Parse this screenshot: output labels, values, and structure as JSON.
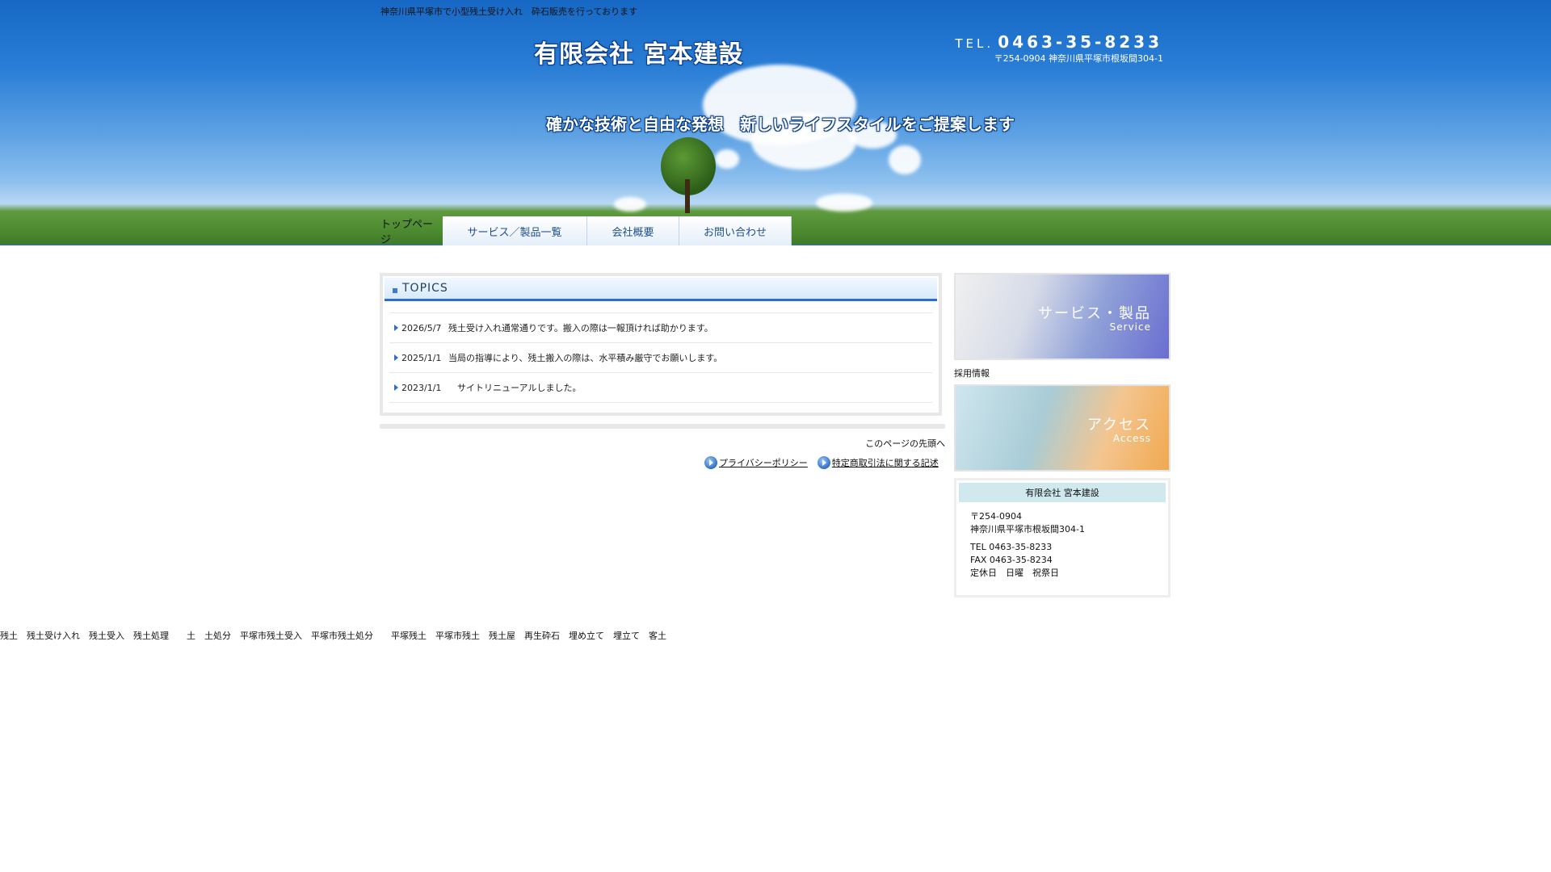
{
  "header": {
    "tagline_top": "神奈川県平塚市で小型残土受け入れ　砕石販売を行っております",
    "logo_text": "有限会社 宮本建設",
    "tel_label": "TEL.",
    "tel_number": "0463-35-8233",
    "address": "〒254-0904 神奈川県平塚市根坂間304-1",
    "catchphrase": "確かな技術と自由な発想　新しいライフスタイルをご提案します"
  },
  "nav": {
    "home": "トップページ",
    "items": [
      "サービス／製品一覧",
      "会社概要",
      "お問い合わせ"
    ]
  },
  "topics": {
    "title": "TOPICS",
    "items": [
      {
        "date": "2026/5/7",
        "text": "残土受け入れ通常通りです。搬入の際は一報頂ければ助かります。"
      },
      {
        "date": "2025/1/1",
        "text": "当局の指導により、残土搬入の際は、水平積み厳守でお願いします。"
      },
      {
        "date": "2023/1/1",
        "text": "　サイトリニューアルしました。"
      }
    ]
  },
  "pagetop": "このページの先頭へ",
  "footer_links": [
    "プライバシーポリシー",
    "特定商取引法に関する記述"
  ],
  "sidebar": {
    "service_banner": {
      "title": "サービス・製品",
      "sub": "Service"
    },
    "recruit": "採用情報",
    "access_banner": {
      "title": "アクセス",
      "sub": "Access"
    },
    "company": {
      "name": "有限会社 宮本建設",
      "postal": "〒254-0904",
      "address": "神奈川県平塚市根坂間304-1",
      "tel": "TEL 0463-35-8233",
      "fax": "FAX 0463-35-8234",
      "holiday": "定休日　日曜　祝祭日"
    }
  },
  "keywords": "残土　残土受け入れ　残土受入　残土処理　　土　土処分　平塚市残土受入　平塚市残土処分　　平塚残土　平塚市残土　残土屋　再生砕石　埋め立て　埋立て　客土",
  "colors": {
    "accent": "#2b6fc8",
    "header_sky": "#1668c4",
    "company_label_bg": "#cfe9ee"
  }
}
